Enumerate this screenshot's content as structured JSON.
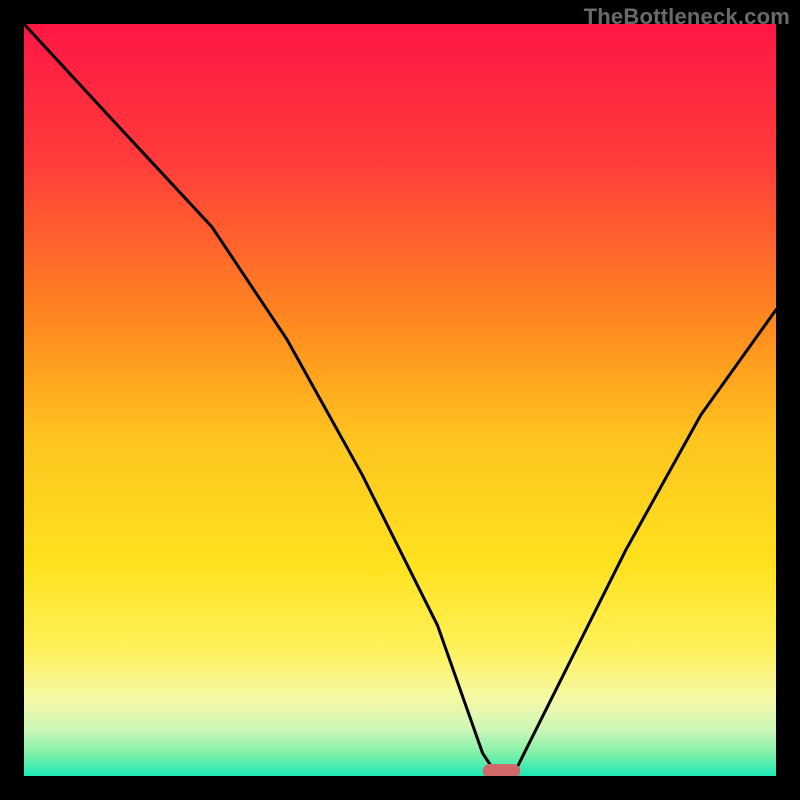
{
  "watermark": "TheBottleneck.com",
  "chart_data": {
    "type": "line",
    "title": "",
    "xlabel": "",
    "ylabel": "",
    "xlim": [
      0,
      100
    ],
    "ylim": [
      0,
      100
    ],
    "series": [
      {
        "name": "curve",
        "x": [
          0,
          12,
          25,
          35,
          45,
          55,
          61,
          63,
          65,
          70,
          80,
          90,
          100
        ],
        "values": [
          100,
          87,
          73,
          58,
          40,
          20,
          3,
          0,
          0,
          10,
          30,
          48,
          62
        ]
      }
    ],
    "optimum_marker": {
      "x_start": 61,
      "x_end": 66,
      "y": 0
    },
    "background_gradient_stops": [
      {
        "offset": 0.0,
        "color": "#ff1744"
      },
      {
        "offset": 0.18,
        "color": "#ff3b3b"
      },
      {
        "offset": 0.4,
        "color": "#ff8a1f"
      },
      {
        "offset": 0.55,
        "color": "#ffc41f"
      },
      {
        "offset": 0.72,
        "color": "#ffe21f"
      },
      {
        "offset": 0.83,
        "color": "#fff15a"
      },
      {
        "offset": 0.9,
        "color": "#f4f9a8"
      },
      {
        "offset": 0.94,
        "color": "#c9f7b8"
      },
      {
        "offset": 0.97,
        "color": "#7ff0a8"
      },
      {
        "offset": 1.0,
        "color": "#1de9b6"
      }
    ],
    "stroke_color": "#000000",
    "marker_color": "#d06a6a"
  }
}
